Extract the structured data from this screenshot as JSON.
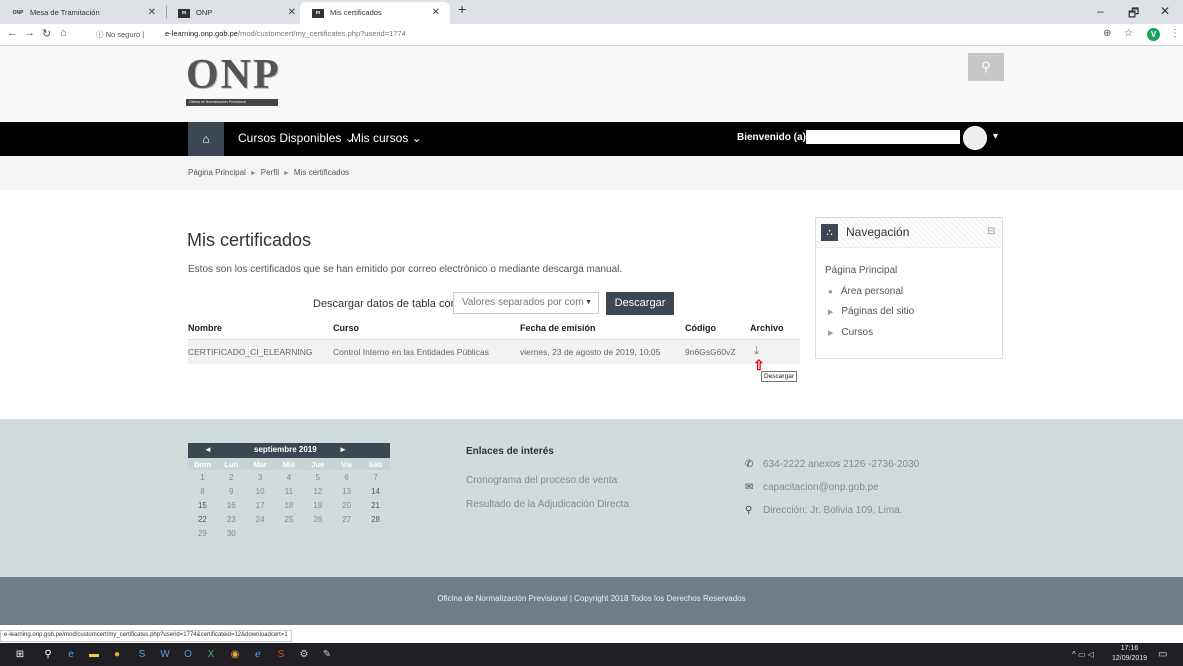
{
  "browser": {
    "tabs": [
      {
        "label": "Mesa de Tramitación",
        "icon": "onp-favicon"
      },
      {
        "label": "ONP",
        "icon": "moodle-favicon"
      },
      {
        "label": "Mis certificados",
        "icon": "moodle-favicon"
      }
    ],
    "new_tab": "+",
    "secure_label": "No seguro",
    "url_host": "e-learning.onp.gob.pe",
    "url_path": "/mod/customcert/my_certificates.php?userid=1774",
    "profile_initial": "V",
    "win_min": "–",
    "win_max": "🗗",
    "win_close": "✕"
  },
  "site": {
    "logo_text": "ONP",
    "logo_tagline": "Oficina de Normalización Previsional",
    "nav": {
      "cursos_disponibles": "Cursos Disponibles ⌄",
      "mis_cursos": "Mis cursos ⌄",
      "welcome": "Bienvenido (a):"
    },
    "breadcrumb": [
      "Página Principal",
      "Perfil",
      "Mis certificados"
    ]
  },
  "main": {
    "title": "Mis certificados",
    "intro": "Estos son los certificados que se han emitido por correo electrónico o mediante descarga manual.",
    "download": {
      "label": "Descargar datos de tabla como",
      "select_value": "Valores separados por com",
      "button": "Descargar"
    },
    "table": {
      "headers": [
        "Nombre",
        "Curso",
        "Fecha de emisión",
        "Código",
        "Archivo"
      ],
      "rows": [
        {
          "nombre": "CERTIFICADO_CI_ELEARNING",
          "curso": "Control Interno en las Entidades Públicas",
          "fecha": "viernes, 23 de agosto de 2019, 10:05",
          "codigo": "9n6GsG60vZ"
        }
      ]
    },
    "tooltip": "Descargar"
  },
  "navigation_block": {
    "title": "Navegación",
    "items": [
      "Página Principal",
      "Área personal",
      "Páginas del sitio",
      "Cursos"
    ]
  },
  "footer": {
    "calendar": {
      "prev": "◄",
      "title": "septiembre 2019",
      "next": "►",
      "days": [
        "Dom",
        "Lun",
        "Mar",
        "Mié",
        "Jue",
        "Vie",
        "Sáb"
      ],
      "weeks": [
        [
          "1",
          "2",
          "3",
          "4",
          "5",
          "6",
          "7"
        ],
        [
          "8",
          "9",
          "10",
          "11",
          "12",
          "13",
          "14"
        ],
        [
          "15",
          "16",
          "17",
          "18",
          "19",
          "20",
          "21"
        ],
        [
          "22",
          "23",
          "24",
          "25",
          "26",
          "27",
          "28"
        ],
        [
          "29",
          "30",
          "",
          "",
          "",
          "",
          ""
        ]
      ]
    },
    "links_title": "Enlaces de interés",
    "links": [
      "Cronograma del proceso de venta",
      "Resultado de la Adjudicación Directa"
    ],
    "contact": {
      "phone": "634-2222 anexos 2126 -2736-2030",
      "email": "capacitacion@onp.gob.pe",
      "address": "Dirección: Jr. Bolivia 109, Lima."
    },
    "copyright": "Oficina de Normalización Previsional | Copyright 2018 Todos los Derechos Reservados"
  },
  "status_url": "e-learning.onp.gob.pe/mod/customcert/my_certificates.php?userid=1774&certificateid=12&downloadcert=1",
  "taskbar": {
    "time": "17:16",
    "date": "12/09/2019"
  }
}
